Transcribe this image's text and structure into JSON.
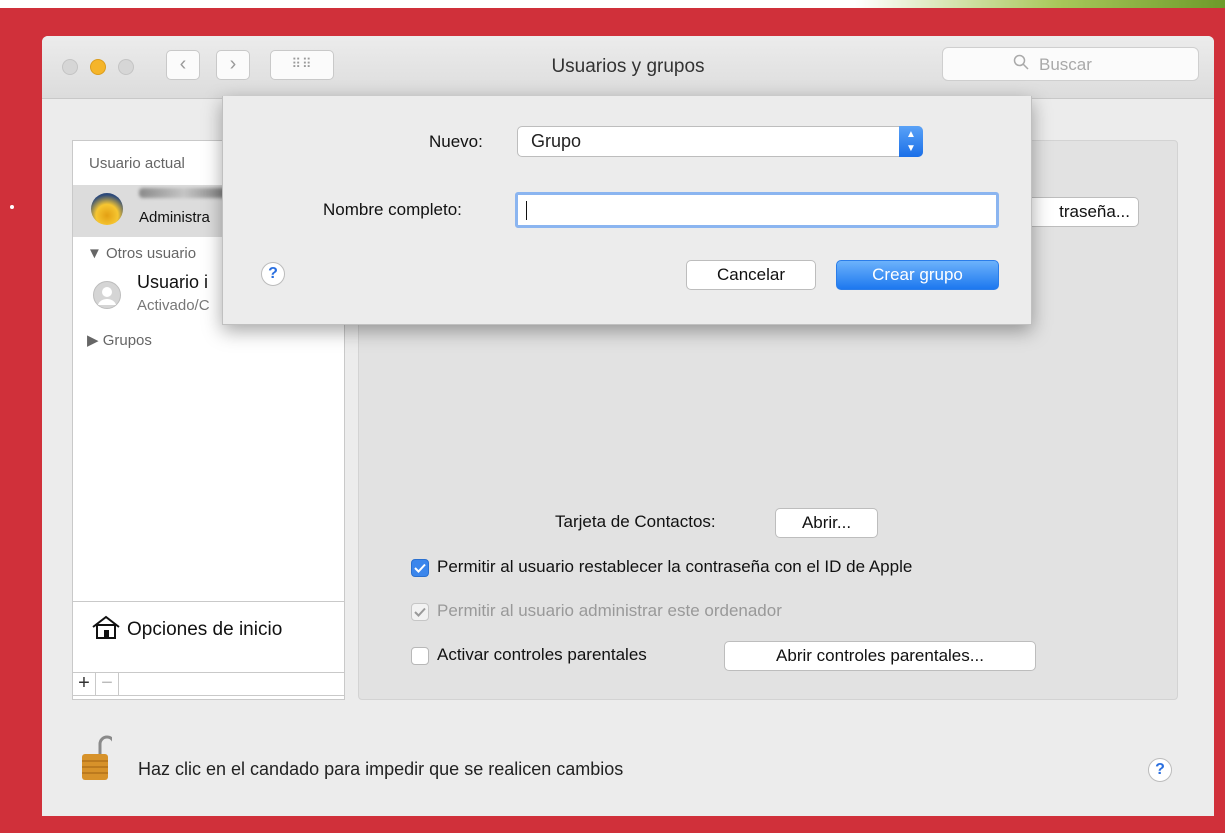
{
  "window": {
    "title": "Usuarios y grupos",
    "search_placeholder": "Buscar"
  },
  "sidebar": {
    "current_user_header": "Usuario actual",
    "current_user_role": "Administra",
    "others_header": "Otros usuario",
    "guest_name": "Usuario i",
    "guest_status": "Activado/C",
    "groups_header": "Grupos",
    "login_options": "Opciones de inicio",
    "add_label": "+",
    "remove_label": "−"
  },
  "panel": {
    "change_password_label": "traseña...",
    "contacts_card_label": "Tarjeta de Contactos:",
    "open_button": "Abrir...",
    "allow_reset_label": "Permitir al usuario restablecer la contraseña con el ID de Apple",
    "allow_admin_label": "Permitir al usuario administrar este ordenador",
    "parental_label": "Activar controles parentales",
    "open_parental_button": "Abrir controles parentales...",
    "allow_reset_checked": true,
    "allow_admin_checked": true,
    "parental_checked": false
  },
  "footer": {
    "lock_text": "Haz clic en el candado para impedir que se realicen cambios",
    "help": "?"
  },
  "sheet": {
    "new_label": "Nuevo:",
    "new_value": "Grupo",
    "fullname_label": "Nombre completo:",
    "fullname_value": "",
    "help": "?",
    "cancel_button": "Cancelar",
    "create_button": "Crear grupo"
  },
  "colors": {
    "frame": "#d0303a",
    "accent": "#1d78ef"
  }
}
